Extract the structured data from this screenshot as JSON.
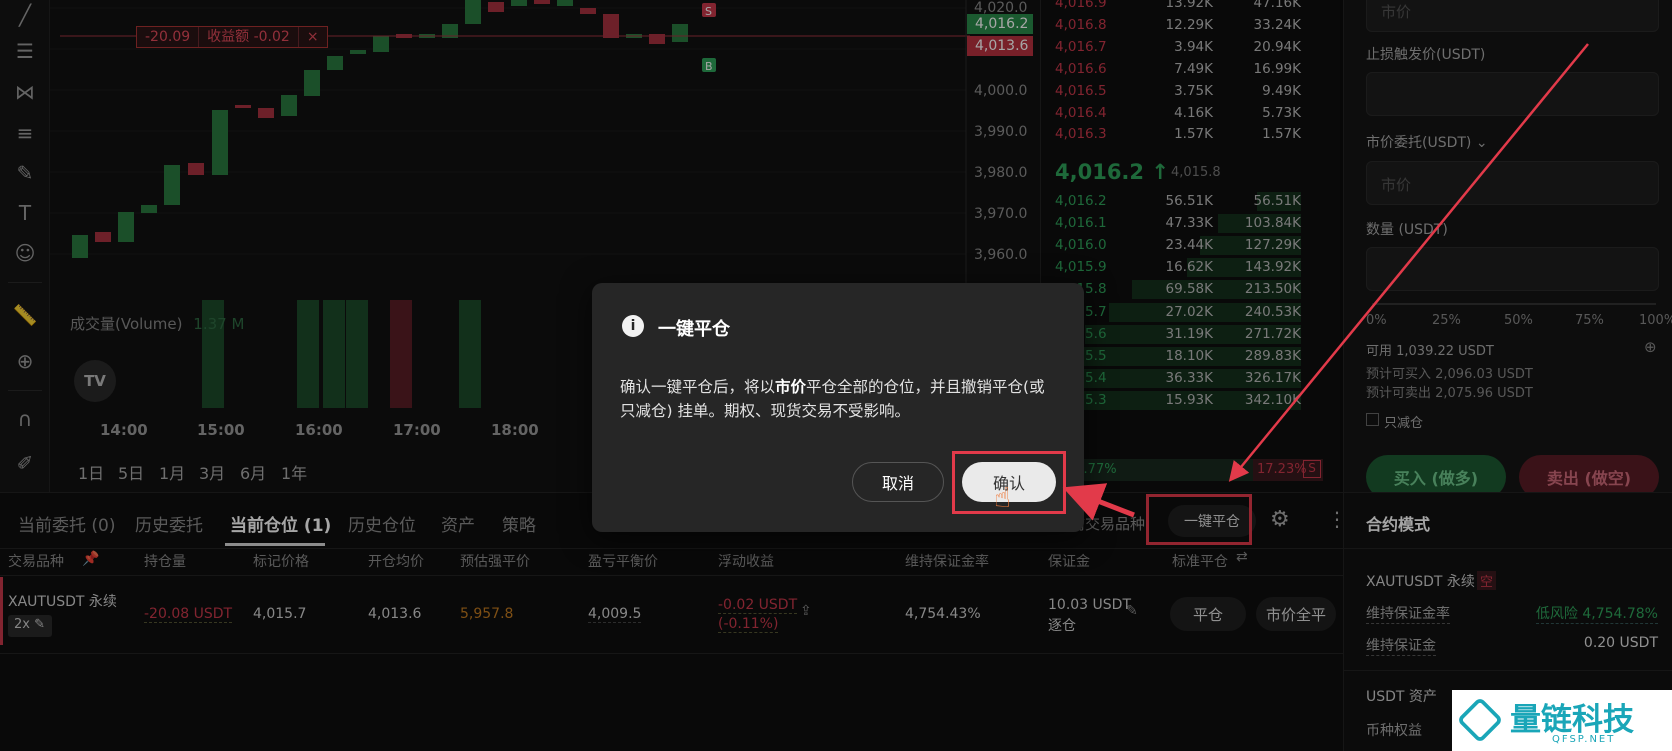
{
  "chart": {
    "price_ticks": [
      "4,020.0",
      "4,000.0",
      "3,990.0",
      "3,980.0",
      "3,970.0",
      "3,960.0"
    ],
    "price_tag_current": "4,016.2",
    "price_tag_entry": "4,013.6",
    "pl_line": {
      "value": "-20.09",
      "label": "收益额 -0.02",
      "close": "×"
    },
    "volume_label": "成交量(Volume)",
    "volume_value": "1.37 M",
    "time_ticks": [
      "14:00",
      "15:00",
      "16:00",
      "17:00",
      "18:00"
    ],
    "intervals": [
      "1日",
      "5日",
      "1月",
      "3月",
      "6月",
      "1年"
    ],
    "tv_logo": "TV",
    "marker_sell": "S",
    "marker_buy": "B"
  },
  "orderbook": {
    "asks": [
      {
        "price": "4,016.9",
        "qty": "13.92K",
        "total": "47.16K"
      },
      {
        "price": "4,016.8",
        "qty": "12.29K",
        "total": "33.24K"
      },
      {
        "price": "4,016.7",
        "qty": "3.94K",
        "total": "20.94K"
      },
      {
        "price": "4,016.6",
        "qty": "7.49K",
        "total": "16.99K"
      },
      {
        "price": "4,016.5",
        "qty": "3.75K",
        "total": "9.49K"
      },
      {
        "price": "4,016.4",
        "qty": "4.16K",
        "total": "5.73K"
      },
      {
        "price": "4,016.3",
        "qty": "1.57K",
        "total": "1.57K"
      }
    ],
    "last_price": "4,016.2 ↑",
    "mark_price": "4,015.8",
    "bids": [
      {
        "price": "4,016.2",
        "qty": "56.51K",
        "total": "56.51K",
        "depth": 0.17
      },
      {
        "price": "4,016.1",
        "qty": "47.33K",
        "total": "103.84K",
        "depth": 0.32
      },
      {
        "price": "4,016.0",
        "qty": "23.44K",
        "total": "127.29K",
        "depth": 0.39
      },
      {
        "price": "4,015.9",
        "qty": "16.62K",
        "total": "143.92K",
        "depth": 0.44
      },
      {
        "price": "4,015.8",
        "qty": "69.58K",
        "total": "213.50K",
        "depth": 0.65
      },
      {
        "price": "4,015.7",
        "qty": "27.02K",
        "total": "240.53K",
        "depth": 0.74
      },
      {
        "price": "4,015.6",
        "qty": "31.19K",
        "total": "271.72K",
        "depth": 0.83
      },
      {
        "price": "4,015.5",
        "qty": "18.10K",
        "total": "289.83K",
        "depth": 0.89
      },
      {
        "price": "4,015.4",
        "qty": "36.33K",
        "total": "326.17K",
        "depth": 1.0
      },
      {
        "price": "4,015.3",
        "qty": "15.93K",
        "total": "342.10K",
        "depth": 1.0
      }
    ],
    "buy_ratio": "82.77%",
    "sell_ratio": "17.23%",
    "sell_ratio_badge": "S"
  },
  "trade_panel": {
    "price_placeholder": "市价",
    "stop_loss_label": "止损触发价(USDT)",
    "market_order_label": "市价委托(USDT)",
    "market_placeholder": "市价",
    "qty_label": "数量 (USDT)",
    "slider_marks": [
      "0%",
      "25%",
      "50%",
      "75%",
      "100%"
    ],
    "available": "可用 1,039.22 USDT",
    "est_buy": "预计可买入 2,096.03 USDT",
    "est_sell": "预计可卖出 2,075.96 USDT",
    "reduce_only": "只减仓",
    "buy_button": "买入 (做多)",
    "sell_button": "卖出 (做空)"
  },
  "bottom": {
    "tabs": [
      "当前委托 (0)",
      "历史委托",
      "当前仓位 (1)",
      "历史仓位",
      "资产",
      "策略"
    ],
    "filter_label": "当前交易品种",
    "close_all_button": "一键平仓",
    "columns": [
      "交易品种",
      "持仓量",
      "标记价格",
      "开仓均价",
      "预估强平价",
      "盈亏平衡价",
      "浮动收益",
      "维持保证金率",
      "保证金",
      "标准平仓"
    ],
    "position": {
      "symbol": "XAUTUSDT 永续",
      "leverage": "2x",
      "size": "-20.08 USDT",
      "mark_price": "4,015.7",
      "entry_price": "4,013.6",
      "liq_price": "5,957.8",
      "breakeven": "4,009.5",
      "pnl": "-0.02 USDT",
      "pnl_pct": "(-0.11%)",
      "mmr": "4,754.43%",
      "margin": "10.03 USDT",
      "margin_mode": "逐仓",
      "close_button": "平仓",
      "market_close_button": "市价全平"
    }
  },
  "contract": {
    "title": "合约模式",
    "symbol": "XAUTUSDT 永续",
    "side_badge": "空",
    "mmr_label": "维持保证金率",
    "mmr_value": "低风险 4,754.78%",
    "mm_label": "维持保证金",
    "mm_value": "0.20 USDT",
    "assets_title": "USDT 资产",
    "equity_label": "币种权益"
  },
  "modal": {
    "title": "一键平仓",
    "body_pre": "确认一键平仓后，将以",
    "body_bold": "市价",
    "body_post": "平仓全部的仓位，并且撤销平仓(或只减仓) 挂单。期权、现货交易不受影响。",
    "cancel": "取消",
    "confirm": "确认"
  },
  "watermark": {
    "text": "量链科技",
    "sub": "QFSP.NET"
  },
  "colors": {
    "up": "#2fa15a",
    "down": "#c8384a",
    "annotation": "#e23a4a"
  }
}
